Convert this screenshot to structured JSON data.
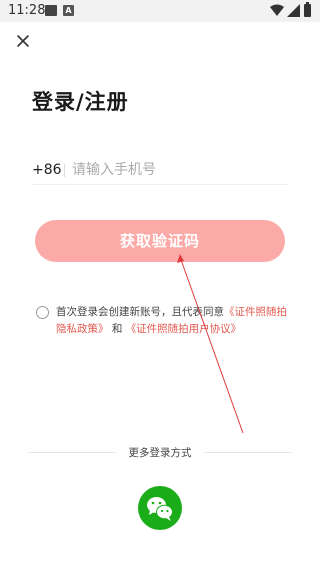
{
  "status_bar": {
    "time": "11:28",
    "notif_letter": "A"
  },
  "header": {
    "title": "登录/注册"
  },
  "phone": {
    "prefix": "+86",
    "placeholder": "请输入手机号",
    "value": ""
  },
  "code_button": {
    "label": "获取验证码"
  },
  "agreement": {
    "text_before": "首次登录会创建新账号，且代表同意",
    "privacy_link": "《证件照随拍隐私政策》",
    "conjunction": "和",
    "user_agreement_link": "《证件照随拍用户协议》",
    "checked": false
  },
  "other_login": {
    "label": "更多登录方式",
    "method": "wechat-icon"
  },
  "colors": {
    "primary_button": "#fbaaa8",
    "link": "#e05a4f",
    "wechat": "#1aad19",
    "arrow": "#e03b3b"
  }
}
